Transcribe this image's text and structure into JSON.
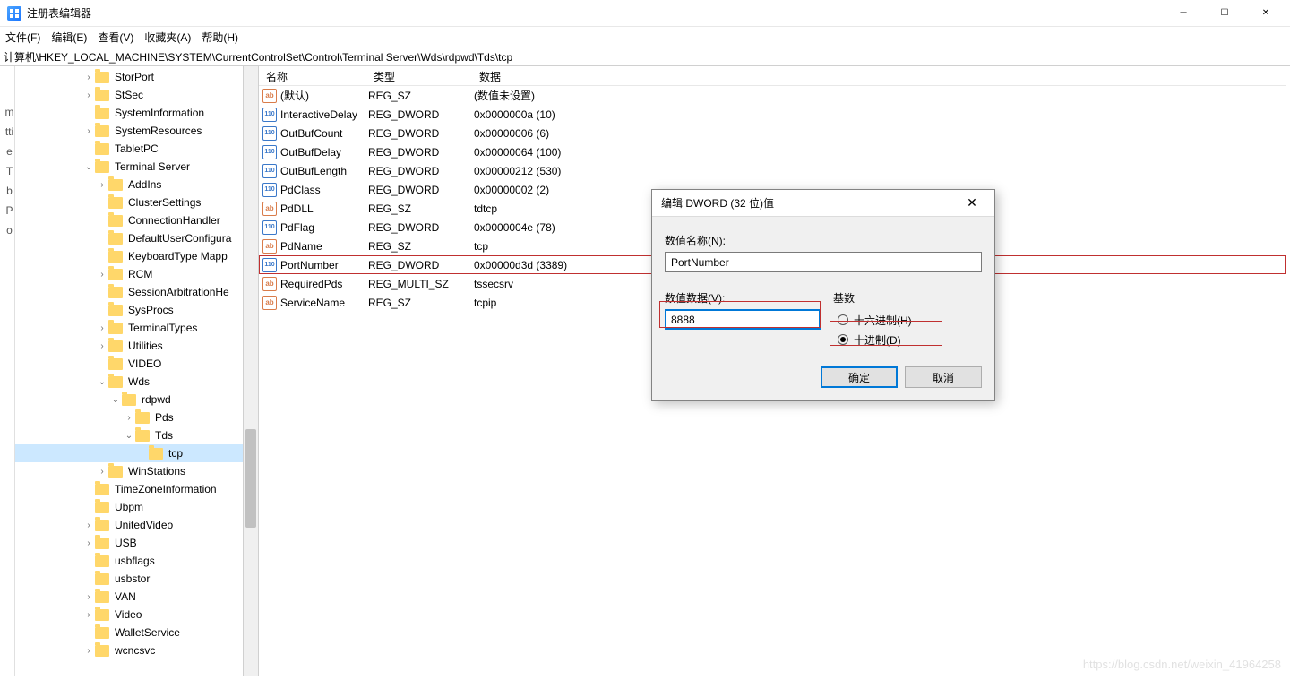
{
  "window": {
    "title": "注册表编辑器"
  },
  "menu": {
    "file": "文件(F)",
    "edit": "编辑(E)",
    "view": "查看(V)",
    "fav": "收藏夹(A)",
    "help": "帮助(H)"
  },
  "address": "计算机\\HKEY_LOCAL_MACHINE\\SYSTEM\\CurrentControlSet\\Control\\Terminal Server\\Wds\\rdpwd\\Tds\\tcp",
  "left_gutter": [
    "m",
    "",
    "",
    "tti",
    "",
    "e",
    "",
    "T",
    "",
    "b",
    "",
    "",
    "P",
    "",
    "",
    "o"
  ],
  "tree": [
    {
      "d": 5,
      "tw": "closed",
      "label": "StorPort"
    },
    {
      "d": 5,
      "tw": "closed",
      "label": "StSec"
    },
    {
      "d": 5,
      "tw": "none",
      "label": "SystemInformation"
    },
    {
      "d": 5,
      "tw": "closed",
      "label": "SystemResources"
    },
    {
      "d": 5,
      "tw": "none",
      "label": "TabletPC"
    },
    {
      "d": 5,
      "tw": "open",
      "label": "Terminal Server"
    },
    {
      "d": 6,
      "tw": "closed",
      "label": "AddIns"
    },
    {
      "d": 6,
      "tw": "none",
      "label": "ClusterSettings"
    },
    {
      "d": 6,
      "tw": "none",
      "label": "ConnectionHandler"
    },
    {
      "d": 6,
      "tw": "none",
      "label": "DefaultUserConfigura"
    },
    {
      "d": 6,
      "tw": "none",
      "label": "KeyboardType Mapp"
    },
    {
      "d": 6,
      "tw": "closed",
      "label": "RCM"
    },
    {
      "d": 6,
      "tw": "none",
      "label": "SessionArbitrationHe"
    },
    {
      "d": 6,
      "tw": "none",
      "label": "SysProcs"
    },
    {
      "d": 6,
      "tw": "closed",
      "label": "TerminalTypes"
    },
    {
      "d": 6,
      "tw": "closed",
      "label": "Utilities"
    },
    {
      "d": 6,
      "tw": "none",
      "label": "VIDEO"
    },
    {
      "d": 6,
      "tw": "open",
      "label": "Wds"
    },
    {
      "d": 7,
      "tw": "open",
      "label": "rdpwd"
    },
    {
      "d": 8,
      "tw": "closed",
      "label": "Pds"
    },
    {
      "d": 8,
      "tw": "open",
      "label": "Tds"
    },
    {
      "d": 9,
      "tw": "none",
      "label": "tcp",
      "selected": true
    },
    {
      "d": 6,
      "tw": "closed",
      "label": "WinStations"
    },
    {
      "d": 5,
      "tw": "none",
      "label": "TimeZoneInformation"
    },
    {
      "d": 5,
      "tw": "none",
      "label": "Ubpm"
    },
    {
      "d": 5,
      "tw": "closed",
      "label": "UnitedVideo"
    },
    {
      "d": 5,
      "tw": "closed",
      "label": "USB"
    },
    {
      "d": 5,
      "tw": "none",
      "label": "usbflags"
    },
    {
      "d": 5,
      "tw": "none",
      "label": "usbstor"
    },
    {
      "d": 5,
      "tw": "closed",
      "label": "VAN"
    },
    {
      "d": 5,
      "tw": "closed",
      "label": "Video"
    },
    {
      "d": 5,
      "tw": "none",
      "label": "WalletService"
    },
    {
      "d": 5,
      "tw": "closed",
      "label": "wcncsvc"
    }
  ],
  "columns": {
    "name": "名称",
    "type": "类型",
    "data": "数据"
  },
  "rows": [
    {
      "ico": "sz",
      "name": "(默认)",
      "type": "REG_SZ",
      "data": "(数值未设置)"
    },
    {
      "ico": "dw",
      "name": "InteractiveDelay",
      "type": "REG_DWORD",
      "data": "0x0000000a (10)"
    },
    {
      "ico": "dw",
      "name": "OutBufCount",
      "type": "REG_DWORD",
      "data": "0x00000006 (6)"
    },
    {
      "ico": "dw",
      "name": "OutBufDelay",
      "type": "REG_DWORD",
      "data": "0x00000064 (100)"
    },
    {
      "ico": "dw",
      "name": "OutBufLength",
      "type": "REG_DWORD",
      "data": "0x00000212 (530)"
    },
    {
      "ico": "dw",
      "name": "PdClass",
      "type": "REG_DWORD",
      "data": "0x00000002 (2)"
    },
    {
      "ico": "sz",
      "name": "PdDLL",
      "type": "REG_SZ",
      "data": "tdtcp"
    },
    {
      "ico": "dw",
      "name": "PdFlag",
      "type": "REG_DWORD",
      "data": "0x0000004e (78)"
    },
    {
      "ico": "sz",
      "name": "PdName",
      "type": "REG_SZ",
      "data": "tcp"
    },
    {
      "ico": "dw",
      "name": "PortNumber",
      "type": "REG_DWORD",
      "data": "0x00000d3d (3389)",
      "hl": true
    },
    {
      "ico": "sz",
      "name": "RequiredPds",
      "type": "REG_MULTI_SZ",
      "data": "tssecsrv"
    },
    {
      "ico": "sz",
      "name": "ServiceName",
      "type": "REG_SZ",
      "data": "tcpip"
    }
  ],
  "dialog": {
    "title": "编辑 DWORD (32 位)值",
    "label_name": "数值名称(N):",
    "name_value": "PortNumber",
    "label_data": "数值数据(V):",
    "data_value": "8888",
    "label_base": "基数",
    "radio_hex": "十六进制(H)",
    "radio_dec": "十进制(D)",
    "ok": "确定",
    "cancel": "取消"
  },
  "watermark": "https://blog.csdn.net/weixin_41964258"
}
